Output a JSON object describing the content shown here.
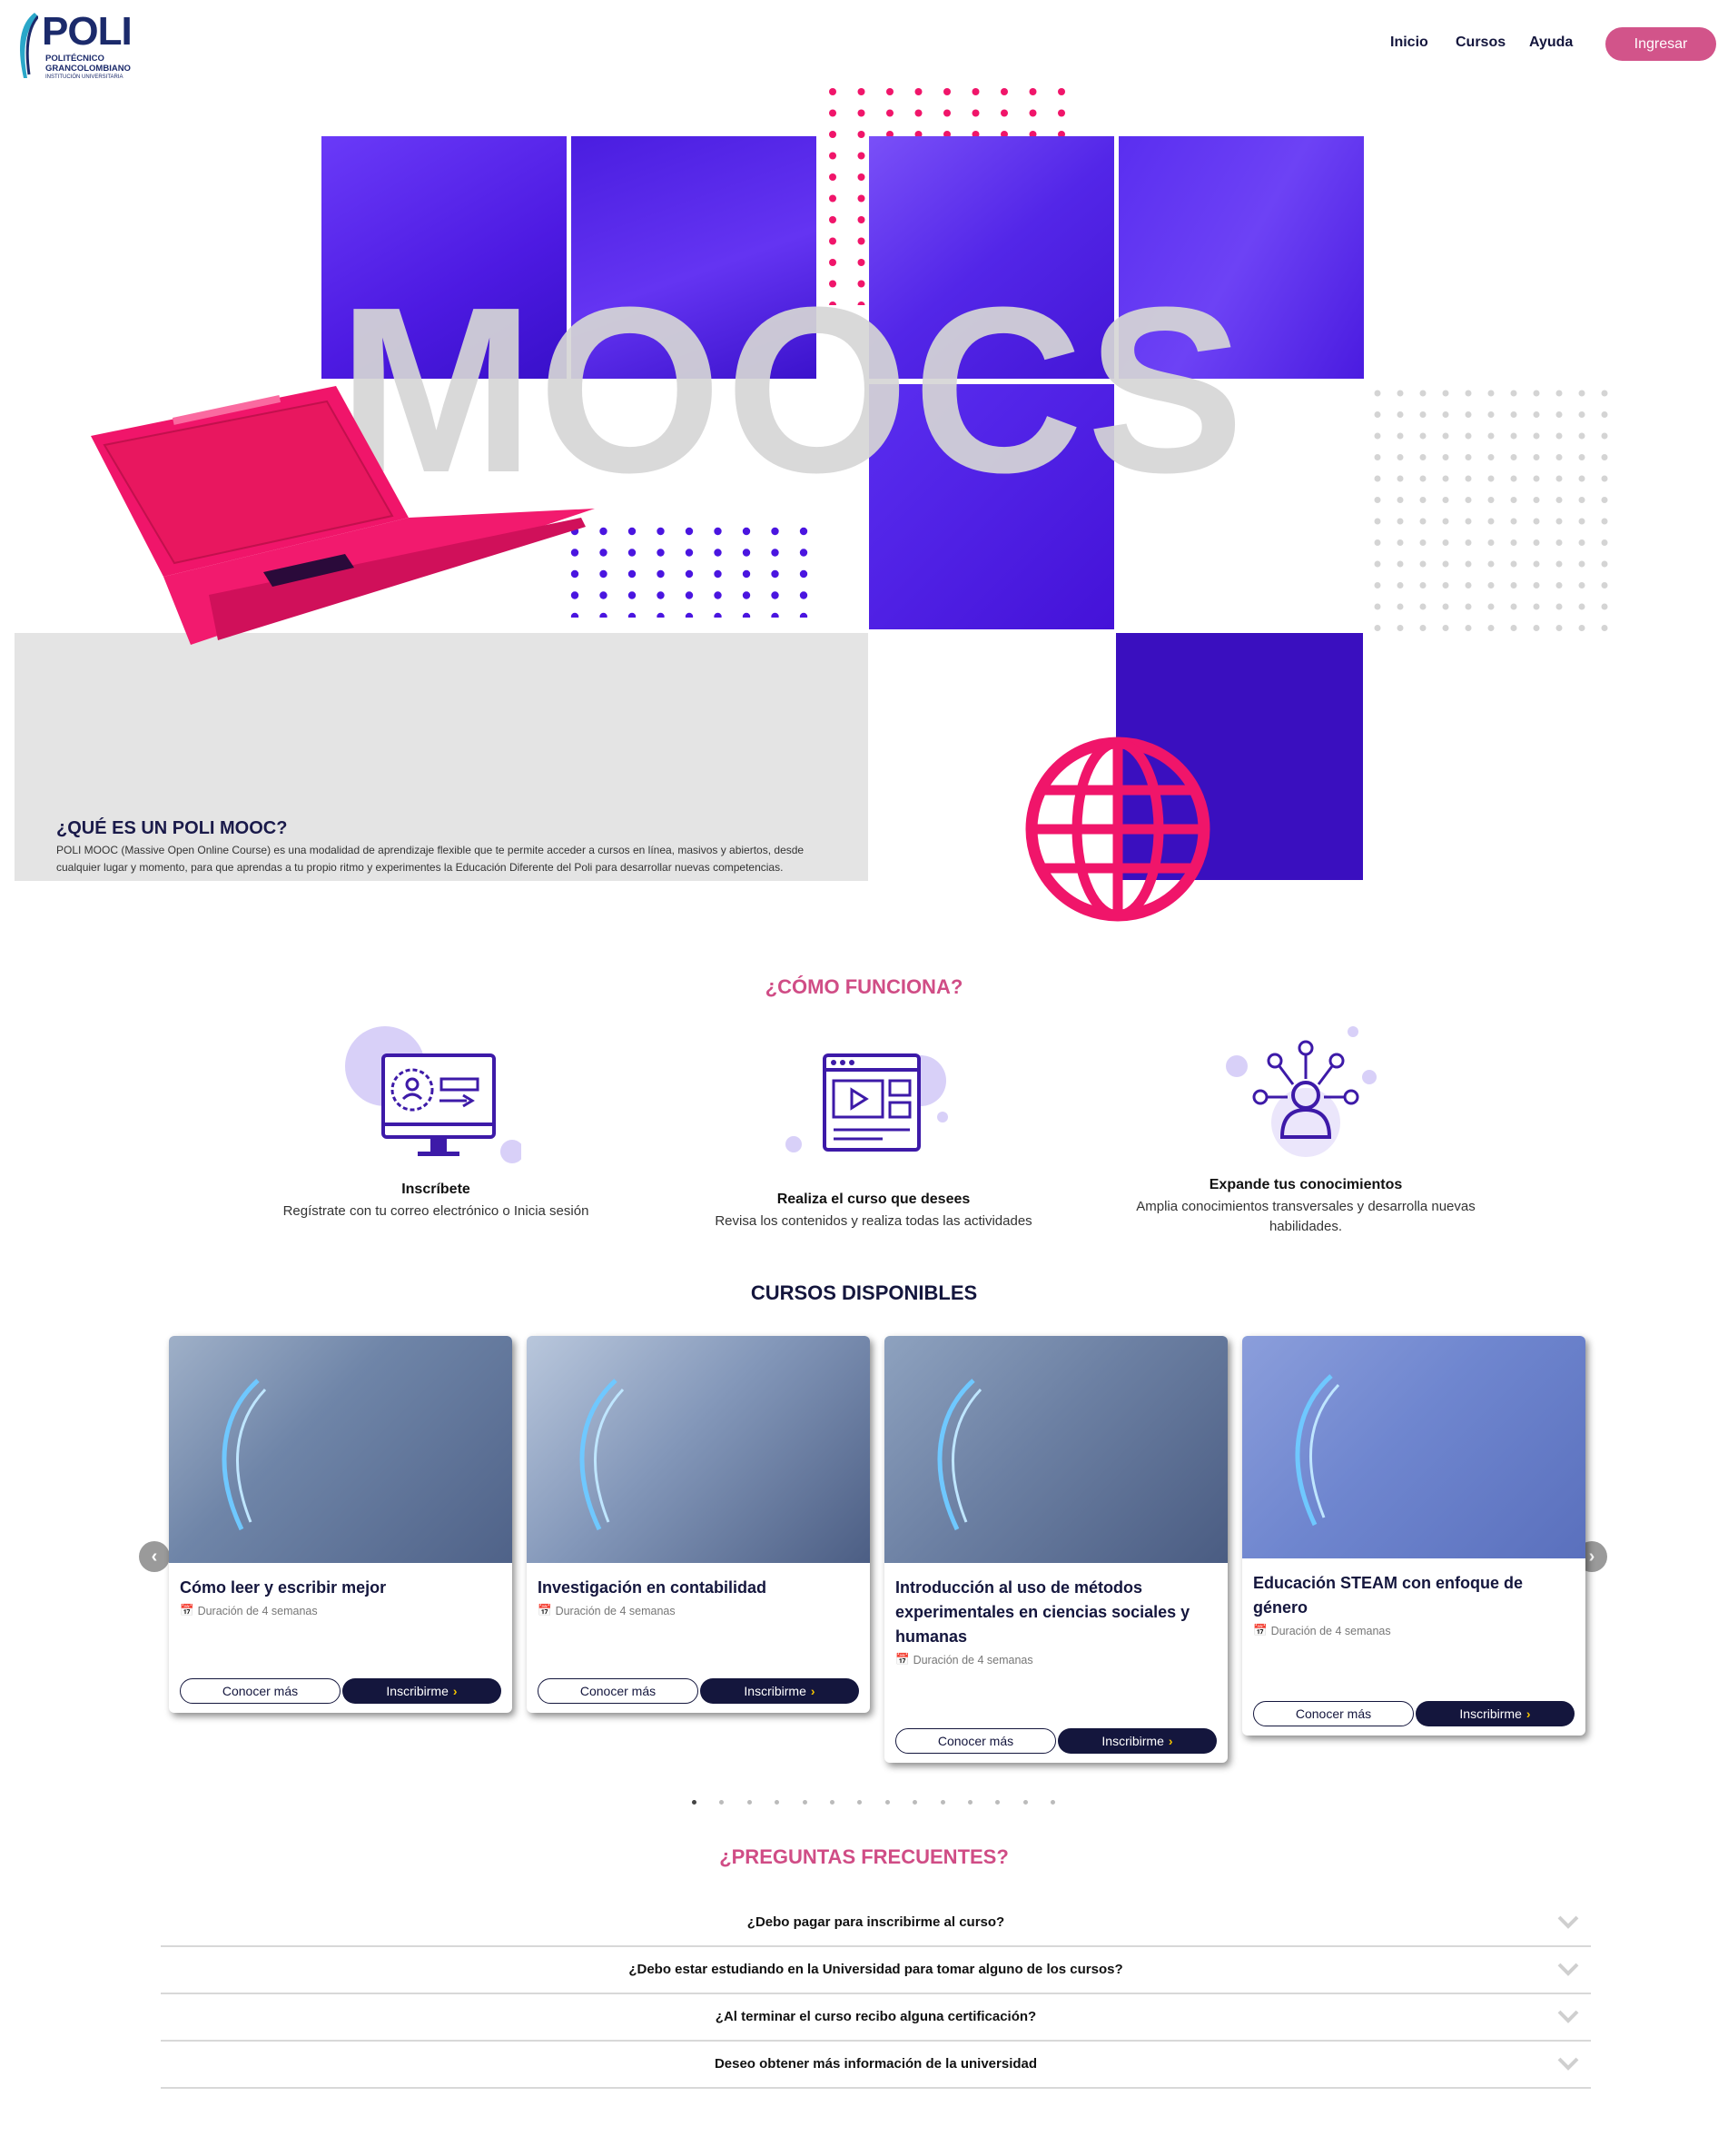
{
  "header": {
    "logo_word": "POLI",
    "logo_sub1": "POLITÉCNICO",
    "logo_sub2": "GRANCOLOMBIANO",
    "logo_sub3": "INSTITUCIÓN UNIVERSITARIA",
    "nav": [
      "Inicio",
      "Cursos",
      "Ayuda"
    ],
    "login_label": "Ingresar"
  },
  "hero": {
    "big_text": "MOOCS",
    "title": "¿QUÉ ES UN POLI MOOC?",
    "description": "POLI MOOC (Massive Open Online Course) es una modalidad de aprendizaje flexible que te permite acceder a cursos en línea, masivos y abiertos, desde cualquier lugar y momento, para que aprendas a tu propio ritmo y experimentes la Educación Diferente del Poli para desarrollar nuevas competencias."
  },
  "how": {
    "title": "¿CÓMO FUNCIONA?",
    "steps": [
      {
        "title": "Inscríbete",
        "desc": "Regístrate con tu correo electrónico o Inicia sesión",
        "icon": "monitor-user-icon"
      },
      {
        "title": "Realiza el curso que desees",
        "desc": "Revisa los contenidos y realiza todas las actividades",
        "icon": "video-player-icon"
      },
      {
        "title": "Expande tus conocimientos",
        "desc": "Amplia conocimientos transversales y desarrolla nuevas habilidades.",
        "icon": "network-user-icon"
      }
    ]
  },
  "courses": {
    "title": "CURSOS DISPONIBLES",
    "more_label": "Conocer más",
    "enroll_label": "Inscribirme",
    "items": [
      {
        "title": "Cómo leer y escribir mejor",
        "duration": "Duración de 4 semanas"
      },
      {
        "title": "Investigación en contabilidad",
        "duration": "Duración de 4 semanas"
      },
      {
        "title": "Introducción al uso de métodos experimentales en ciencias sociales y humanas",
        "duration": "Duración de 4 semanas"
      },
      {
        "title": "Educación STEAM con enfoque de género",
        "duration": "Duración de 4 semanas"
      }
    ],
    "prev_icon": "‹",
    "next_icon": "›",
    "page_count": 14,
    "active_page": 1
  },
  "faq": {
    "title": "¿PREGUNTAS FRECUENTES?",
    "questions": [
      "¿Debo pagar para inscribirme al curso?",
      "¿Debo estar estudiando en la Universidad para tomar alguno de los cursos?",
      "¿Al terminar el curso recibo alguna certificación?",
      "Deseo obtener más información de la universidad"
    ]
  },
  "colors": {
    "brand_navy": "#14163d",
    "accent_pink": "#d04d86",
    "hero_purple": "#4a15e0",
    "hero_pink": "#f0156a"
  }
}
